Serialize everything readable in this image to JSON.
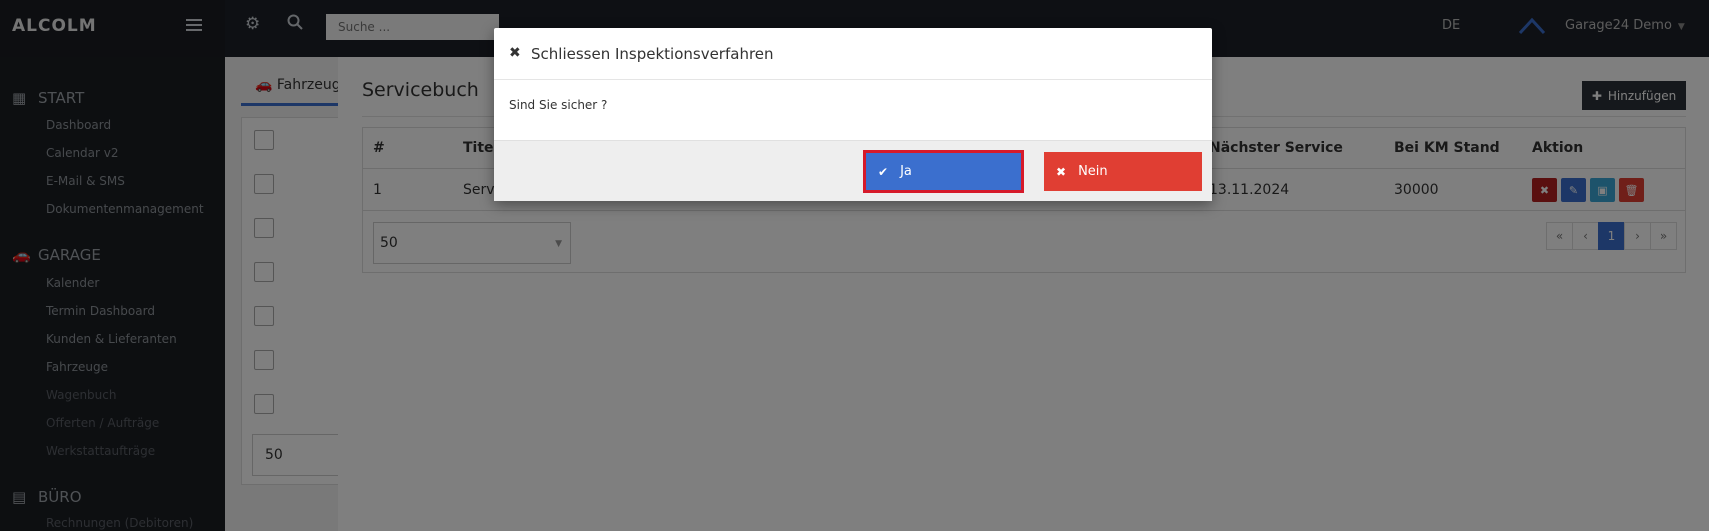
{
  "brand": "ALCOLM",
  "search": {
    "placeholder": "Suche ..."
  },
  "topbar": {
    "lang": "DE",
    "user": "Garage24 Demo"
  },
  "sidebar": {
    "sections": [
      {
        "title": "START",
        "icon": "grid-icon",
        "items": [
          "Dashboard",
          "Calendar v2",
          "E-Mail & SMS",
          "Dokumentenmanagement"
        ]
      },
      {
        "title": "GARAGE",
        "icon": "car-icon",
        "items": [
          "Kalender",
          "Termin Dashboard",
          "Kunden & Lieferanten",
          "Fahrzeuge",
          "Wagenbuch",
          "Offerten / Aufträge",
          "Werkstattaufträge"
        ]
      },
      {
        "title": "BÜRO",
        "icon": "calculator-icon",
        "items": [
          "Rechnungen (Debitoren)"
        ]
      }
    ]
  },
  "content": {
    "tab_label": "Fahrzeuge",
    "left_perpage": "50",
    "title": "Servicebuch",
    "add_label": "Hinzufügen",
    "table": {
      "headers": [
        "#",
        "Titel",
        "Nächster Service",
        "Bei KM Stand",
        "Aktion"
      ],
      "rows": [
        {
          "num": "1",
          "title": "Servi",
          "next_service": "13.11.2024",
          "km": "30000"
        }
      ]
    },
    "perpage": "50",
    "pagination": [
      "«",
      "‹",
      "1",
      "›",
      "»"
    ]
  },
  "modal": {
    "title": "Schliessen Inspektionsverfahren",
    "body": "Sind Sie sicher ?",
    "yes_label": "Ja",
    "no_label": "Nein"
  },
  "colors": {
    "primary": "#3b6fce",
    "danger": "#e03e33",
    "dark": "#2b3038",
    "highlight": "#d61a2a"
  }
}
